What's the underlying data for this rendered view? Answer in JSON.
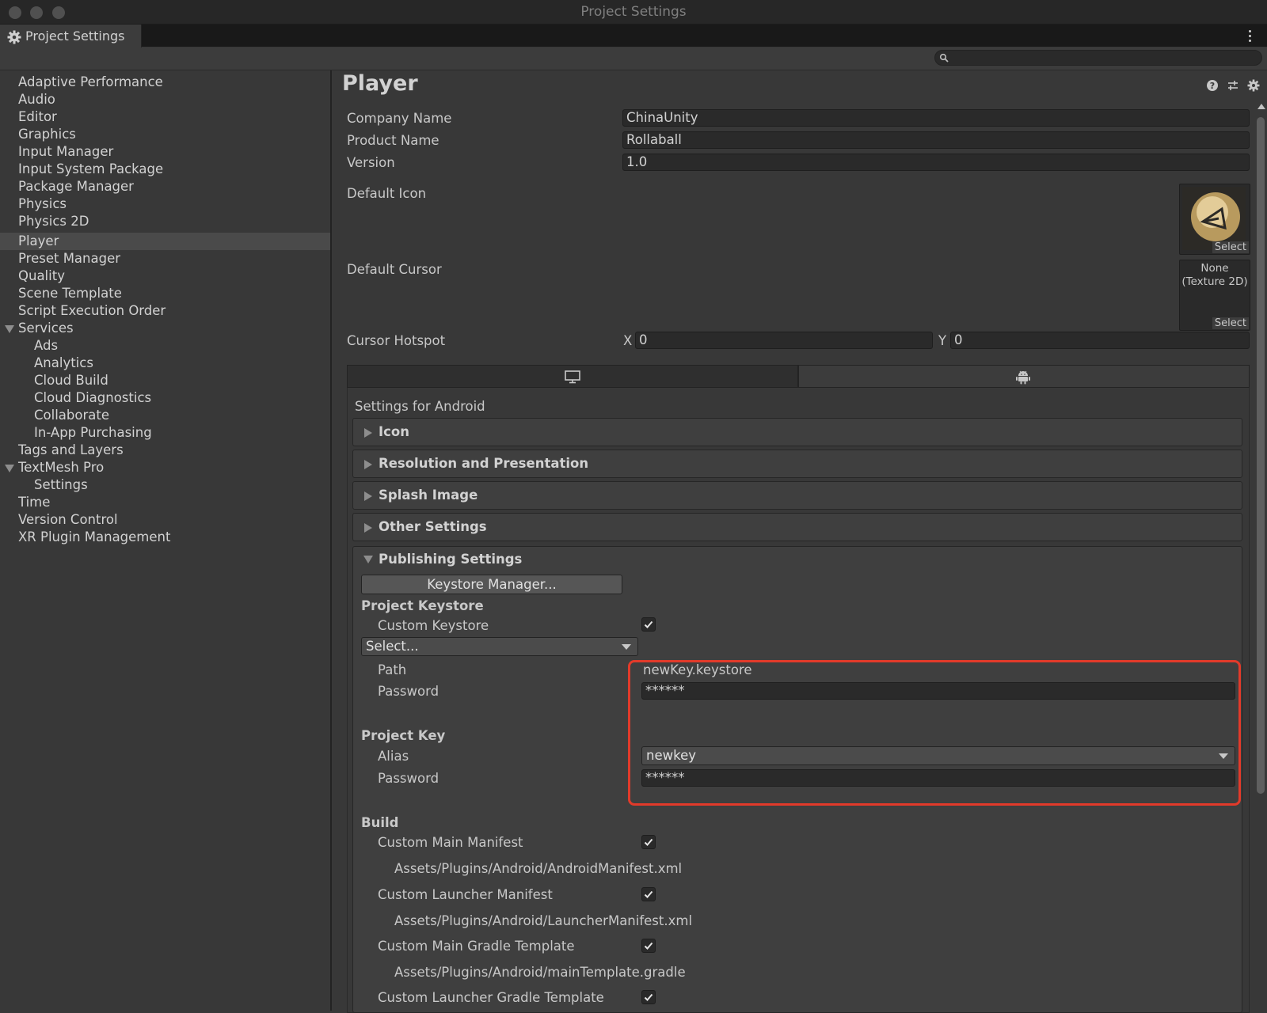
{
  "window": {
    "title": "Project Settings"
  },
  "tab": {
    "label": "Project Settings"
  },
  "search": {
    "placeholder": ""
  },
  "sidebar": {
    "items": [
      "Adaptive Performance",
      "Audio",
      "Editor",
      "Graphics",
      "Input Manager",
      "Input System Package",
      "Package Manager",
      "Physics",
      "Physics 2D",
      "Player",
      "Preset Manager",
      "Quality",
      "Scene Template",
      "Script Execution Order",
      "Services",
      "Ads",
      "Analytics",
      "Cloud Build",
      "Cloud Diagnostics",
      "Collaborate",
      "In-App Purchasing",
      "Tags and Layers",
      "TextMesh Pro",
      "Settings",
      "Time",
      "Version Control",
      "XR Plugin Management"
    ],
    "selected": "Player"
  },
  "player": {
    "title": "Player",
    "company_name_label": "Company Name",
    "company_name": "ChinaUnity",
    "product_name_label": "Product Name",
    "product_name": "Rollaball",
    "version_label": "Version",
    "version": "1.0",
    "default_icon_label": "Default Icon",
    "icon_select": "Select",
    "default_cursor_label": "Default Cursor",
    "cursor_none": "None",
    "cursor_type": "(Texture 2D)",
    "cursor_select": "Select",
    "cursor_hotspot_label": "Cursor Hotspot",
    "hotspot_x_label": "X",
    "hotspot_x": "0",
    "hotspot_y_label": "Y",
    "hotspot_y": "0"
  },
  "platform": {
    "settings_for": "Settings for Android",
    "sections": [
      "Icon",
      "Resolution and Presentation",
      "Splash Image",
      "Other Settings"
    ]
  },
  "publishing": {
    "title": "Publishing Settings",
    "keystore_manager": "Keystore Manager...",
    "project_keystore": "Project Keystore",
    "custom_keystore_label": "Custom Keystore",
    "custom_keystore_checked": true,
    "select_dropdown": "Select...",
    "path_label": "Path",
    "path_value": "newKey.keystore",
    "password_label": "Password",
    "keystore_password": "******",
    "project_key": "Project Key",
    "alias_label": "Alias",
    "alias_value": "newkey",
    "key_password_label": "Password",
    "key_password": "******"
  },
  "build": {
    "title": "Build",
    "items": [
      {
        "label": "Custom Main Manifest",
        "checked": true,
        "path": "Assets/Plugins/Android/AndroidManifest.xml"
      },
      {
        "label": "Custom Launcher Manifest",
        "checked": true,
        "path": "Assets/Plugins/Android/LauncherManifest.xml"
      },
      {
        "label": "Custom Main Gradle Template",
        "checked": true,
        "path": "Assets/Plugins/Android/mainTemplate.gradle"
      },
      {
        "label": "Custom Launcher Gradle Template",
        "checked": true,
        "path": ""
      }
    ]
  },
  "colors": {
    "highlight_box": "#e23a2a",
    "background": "#383838",
    "selected_row": "#4a4a4a"
  },
  "icons": [
    "gear-icon",
    "kebab-menu-icon",
    "search-icon",
    "help-icon",
    "preset-sliders-icon",
    "settings-gear-icon",
    "monitor-icon",
    "android-icon",
    "checkmark-icon"
  ]
}
